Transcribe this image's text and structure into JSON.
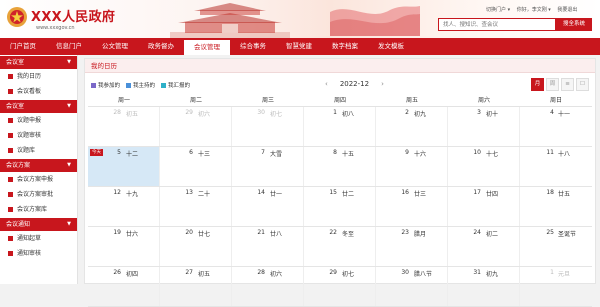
{
  "header": {
    "site_title": "XXX人民政府",
    "site_url": "www.xxxgov.cn",
    "top_links": [
      "切换门户 ▾",
      "你好，李文刚 ▾",
      "我要退出"
    ],
    "search_placeholder": "找人、搜知识、查会议",
    "search_button": "搜全系统"
  },
  "nav": {
    "items": [
      "门户首页",
      "信息门户",
      "公文管理",
      "政务督办",
      "会议管理",
      "综合事务",
      "智慧党建",
      "数字档案",
      "发文模板"
    ],
    "active_index": 4
  },
  "sidebar": {
    "groups": [
      {
        "label": "会议室",
        "items": [
          "我的日历",
          "会议看板"
        ]
      },
      {
        "label": "会议室",
        "items": [
          "议题申报",
          "议题审核",
          "议题库"
        ]
      },
      {
        "label": "会议方案",
        "items": [
          "会议方案申报",
          "会议方案审批",
          "会议方案库"
        ]
      },
      {
        "label": "会议通知",
        "items": [
          "通知起草",
          "通知审核"
        ]
      }
    ]
  },
  "calendar": {
    "panel_title": "我的日历",
    "legend": [
      {
        "label": "我参加的",
        "color": "#7b68c8"
      },
      {
        "label": "我主持的",
        "color": "#4a90d9"
      },
      {
        "label": "我汇报的",
        "color": "#2fb0c8"
      }
    ],
    "month": "2022-12",
    "prev": "‹",
    "next": "›",
    "views": [
      "月",
      "周",
      "≡",
      "☐"
    ],
    "active_view": 0,
    "weekdays": [
      "周一",
      "周二",
      "周三",
      "周四",
      "周五",
      "周六",
      "周日"
    ],
    "today_badge": "今天",
    "weeks": [
      [
        {
          "d": "28",
          "l": "初五",
          "dim": true
        },
        {
          "d": "29",
          "l": "初六",
          "dim": true
        },
        {
          "d": "30",
          "l": "初七",
          "dim": true
        },
        {
          "d": "1",
          "l": "初八"
        },
        {
          "d": "2",
          "l": "初九"
        },
        {
          "d": "3",
          "l": "初十"
        },
        {
          "d": "4",
          "l": "十一"
        }
      ],
      [
        {
          "d": "5",
          "l": "十二",
          "today": true
        },
        {
          "d": "6",
          "l": "十三"
        },
        {
          "d": "7",
          "l": "大雪"
        },
        {
          "d": "8",
          "l": "十五"
        },
        {
          "d": "9",
          "l": "十六"
        },
        {
          "d": "10",
          "l": "十七"
        },
        {
          "d": "11",
          "l": "十八"
        }
      ],
      [
        {
          "d": "12",
          "l": "十九"
        },
        {
          "d": "13",
          "l": "二十"
        },
        {
          "d": "14",
          "l": "廿一"
        },
        {
          "d": "15",
          "l": "廿二"
        },
        {
          "d": "16",
          "l": "廿三"
        },
        {
          "d": "17",
          "l": "廿四"
        },
        {
          "d": "18",
          "l": "廿五"
        }
      ],
      [
        {
          "d": "19",
          "l": "廿六"
        },
        {
          "d": "20",
          "l": "廿七"
        },
        {
          "d": "21",
          "l": "廿八"
        },
        {
          "d": "22",
          "l": "冬至"
        },
        {
          "d": "23",
          "l": "腊月"
        },
        {
          "d": "24",
          "l": "初二"
        },
        {
          "d": "25",
          "l": "圣诞节"
        }
      ],
      [
        {
          "d": "26",
          "l": "初四"
        },
        {
          "d": "27",
          "l": "初五"
        },
        {
          "d": "28",
          "l": "初六"
        },
        {
          "d": "29",
          "l": "初七"
        },
        {
          "d": "30",
          "l": "腊八节"
        },
        {
          "d": "31",
          "l": "初九"
        },
        {
          "d": "1",
          "l": "元旦",
          "dim": true
        }
      ]
    ]
  }
}
